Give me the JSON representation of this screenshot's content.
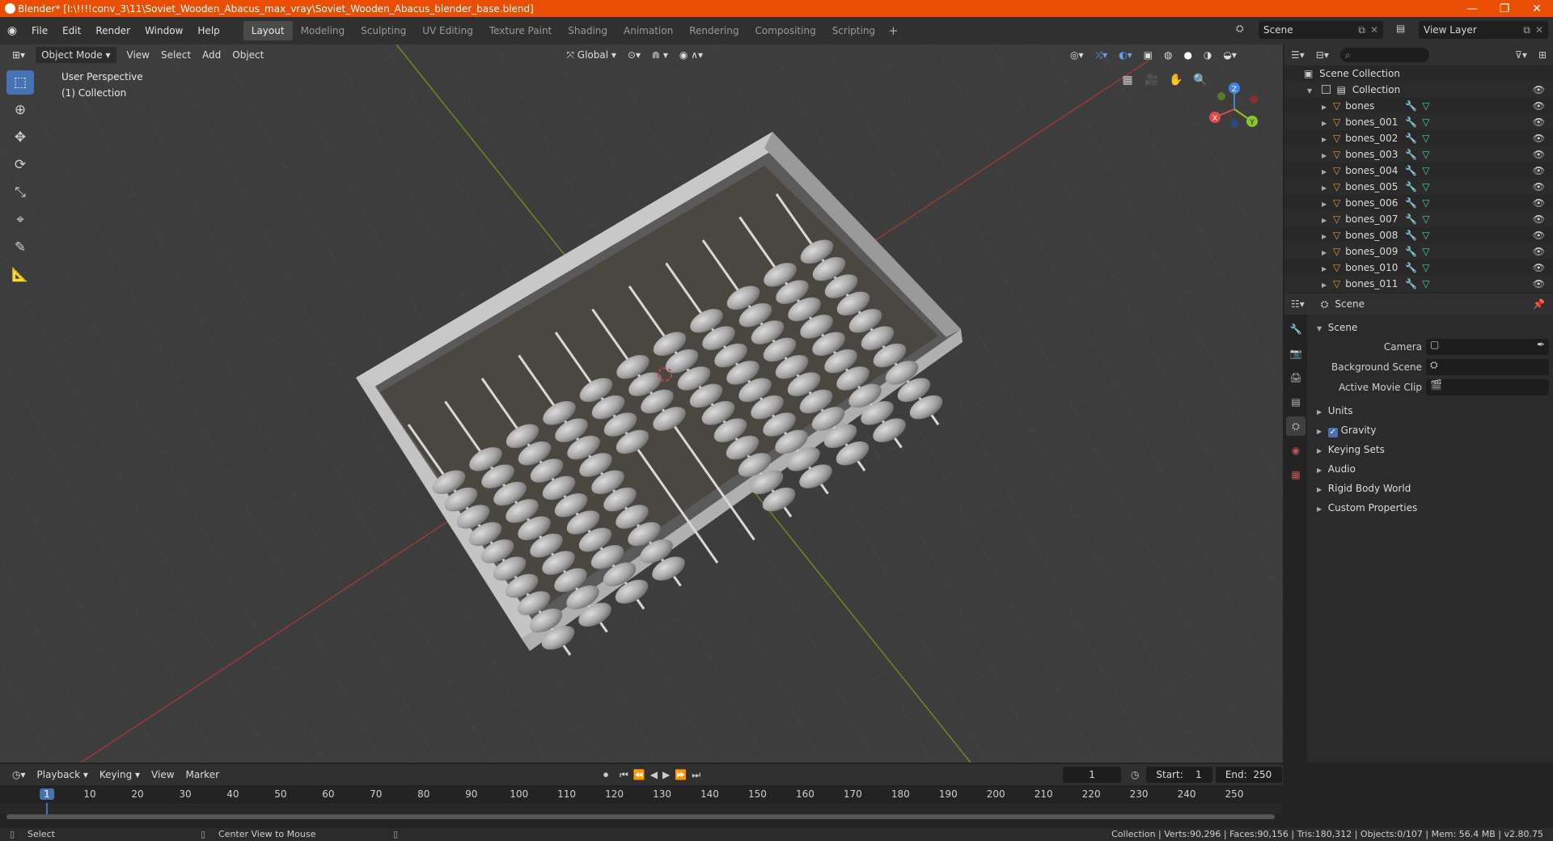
{
  "titlebar": {
    "text": "Blender* [I:\\!!!!conv_3\\11\\Soviet_Wooden_Abacus_max_vray\\Soviet_Wooden_Abacus_blender_base.blend]",
    "minimize": "—",
    "restore": "❐",
    "close": "✕"
  },
  "menu": [
    "File",
    "Edit",
    "Render",
    "Window",
    "Help"
  ],
  "workspaces": [
    "Layout",
    "Modeling",
    "Sculpting",
    "UV Editing",
    "Texture Paint",
    "Shading",
    "Animation",
    "Rendering",
    "Compositing",
    "Scripting"
  ],
  "scene_selector": "Scene",
  "view_layer_selector": "View Layer",
  "viewport": {
    "mode": "Object Mode",
    "menus": [
      "View",
      "Select",
      "Add",
      "Object"
    ],
    "orientation": "Global",
    "info_line1": "User Perspective",
    "info_line2": "(1) Collection",
    "gizmo": {
      "x": "X",
      "y": "Y",
      "z": "Z"
    }
  },
  "outliner": {
    "root": "Scene Collection",
    "collection": "Collection",
    "items": [
      "bones",
      "bones_001",
      "bones_002",
      "bones_003",
      "bones_004",
      "bones_005",
      "bones_006",
      "bones_007",
      "bones_008",
      "bones_009",
      "bones_010",
      "bones_011"
    ]
  },
  "properties": {
    "header": "Scene",
    "section": "Scene",
    "fields": {
      "camera": "Camera",
      "background_scene": "Background Scene",
      "active_movie_clip": "Active Movie Clip"
    },
    "panels": {
      "units": "Units",
      "gravity": "Gravity",
      "keying_sets": "Keying Sets",
      "audio": "Audio",
      "rigid_body_world": "Rigid Body World",
      "custom_properties": "Custom Properties"
    }
  },
  "timeline": {
    "menus": [
      "Playback",
      "Keying",
      "View",
      "Marker"
    ],
    "current_frame": "1",
    "start_label": "Start:",
    "start": "1",
    "end_label": "End:",
    "end": "250",
    "ticks": [
      "1",
      "10",
      "20",
      "30",
      "40",
      "50",
      "60",
      "70",
      "80",
      "90",
      "100",
      "110",
      "120",
      "130",
      "140",
      "150",
      "160",
      "170",
      "180",
      "190",
      "200",
      "210",
      "220",
      "230",
      "240",
      "250"
    ]
  },
  "statusbar": {
    "left": "Select",
    "middle": "Center View to Mouse",
    "right": "Collection | Verts:90,296 | Faces:90,156 | Tris:180,312 | Objects:0/107 | Mem: 56.4 MB | v2.80.75"
  }
}
